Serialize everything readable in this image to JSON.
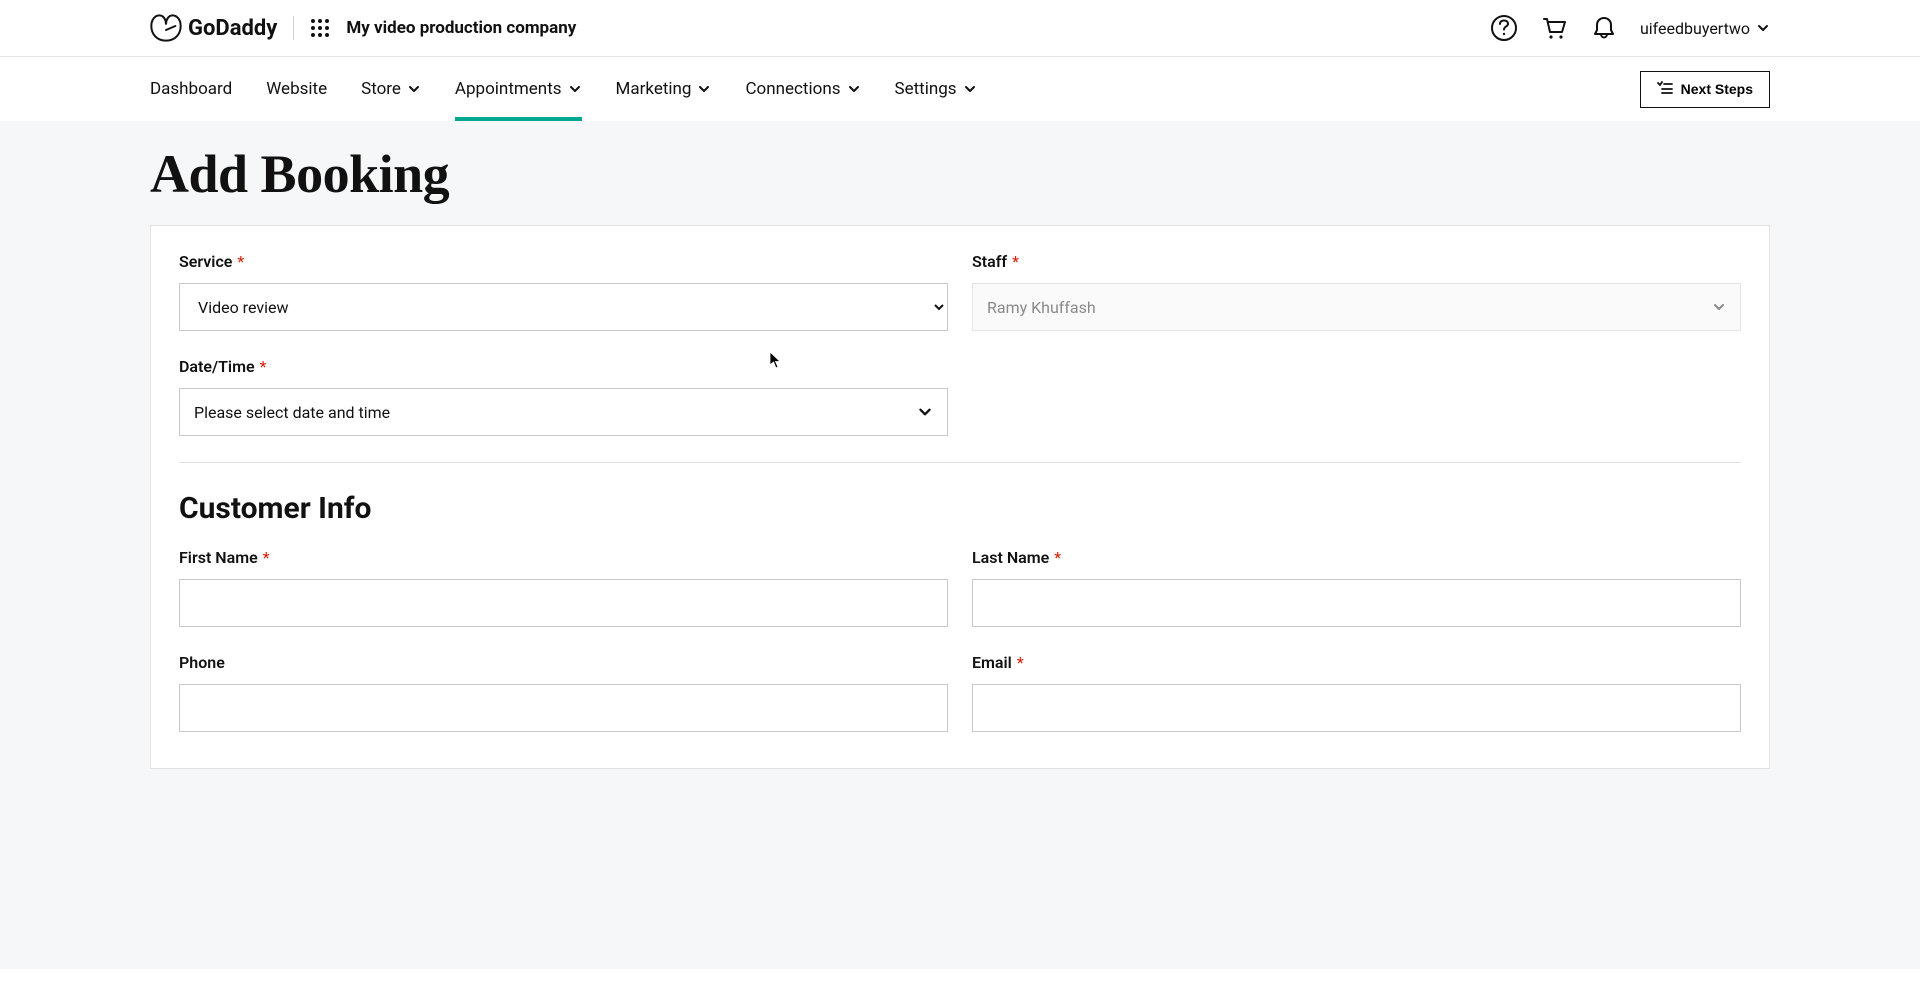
{
  "header": {
    "logo_text": "GoDaddy",
    "company_name": "My video production company",
    "user_name": "uifeedbuyertwo"
  },
  "nav": {
    "items": [
      {
        "label": "Dashboard",
        "dropdown": false,
        "active": false
      },
      {
        "label": "Website",
        "dropdown": false,
        "active": false
      },
      {
        "label": "Store",
        "dropdown": true,
        "active": false
      },
      {
        "label": "Appointments",
        "dropdown": true,
        "active": true
      },
      {
        "label": "Marketing",
        "dropdown": true,
        "active": false
      },
      {
        "label": "Connections",
        "dropdown": true,
        "active": false
      },
      {
        "label": "Settings",
        "dropdown": true,
        "active": false
      }
    ],
    "next_steps_label": "Next Steps"
  },
  "page": {
    "title": "Add Booking"
  },
  "form": {
    "service": {
      "label": "Service",
      "required": true,
      "value": "Video review"
    },
    "staff": {
      "label": "Staff",
      "required": true,
      "value": "Ramy Khuffash",
      "disabled": true
    },
    "datetime": {
      "label": "Date/Time",
      "required": true,
      "placeholder": "Please select date and time"
    },
    "customer_info_heading": "Customer Info",
    "first_name": {
      "label": "First Name",
      "required": true,
      "value": ""
    },
    "last_name": {
      "label": "Last Name",
      "required": true,
      "value": ""
    },
    "phone": {
      "label": "Phone",
      "required": false,
      "value": ""
    },
    "email": {
      "label": "Email",
      "required": true,
      "value": ""
    }
  }
}
